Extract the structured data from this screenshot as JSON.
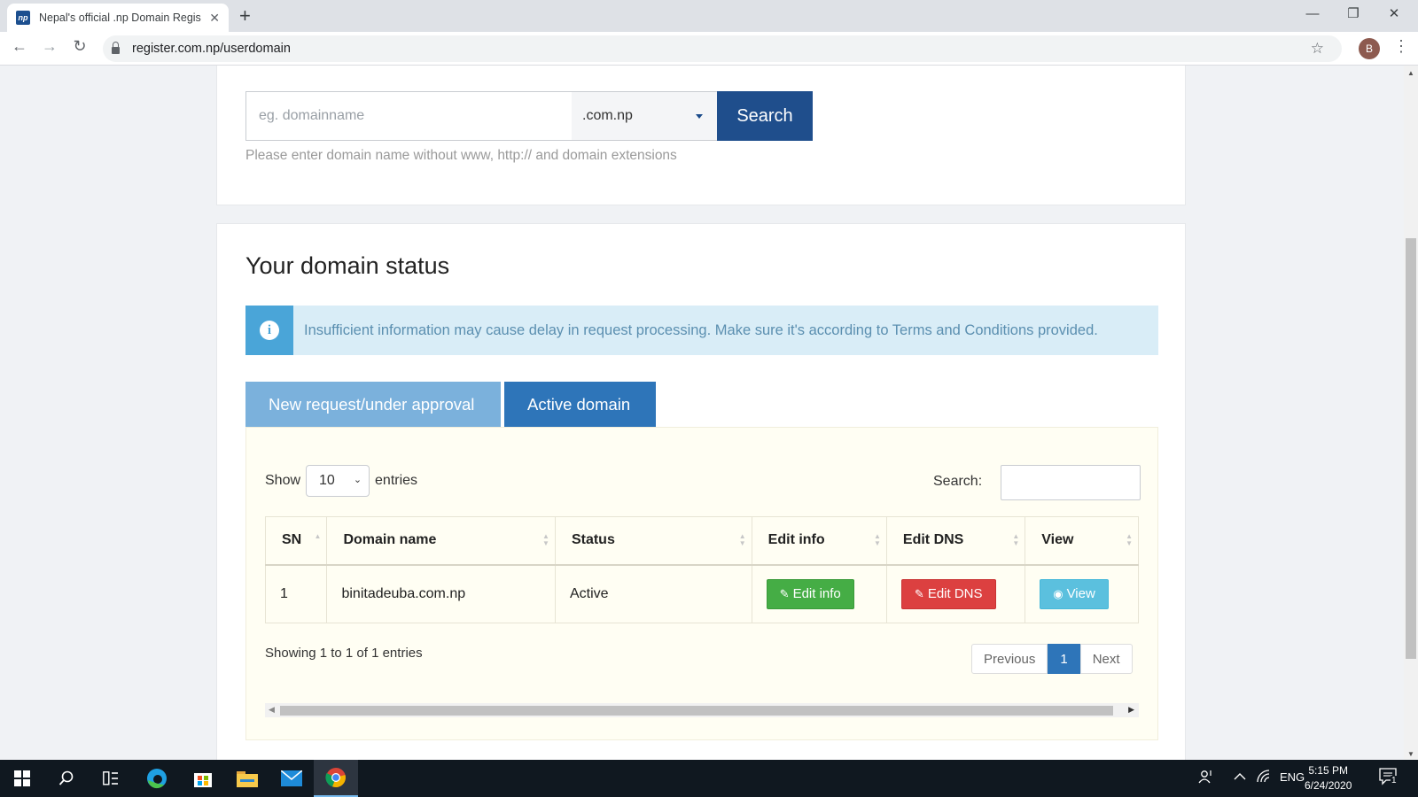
{
  "browser": {
    "tab_title": "Nepal's official .np Domain Regis",
    "tab_favicon_text": "np",
    "tab_close": "✕",
    "new_tab": "+",
    "url": "register.com.np/userdomain",
    "profile_initial": "B",
    "minimize": "—",
    "restore": "❐",
    "close": "✕",
    "back": "←",
    "forward": "→",
    "reload": "↻",
    "star": "☆",
    "menu": "⋮"
  },
  "domain_search": {
    "placeholder": "eg. domainname",
    "extension": ".com.np",
    "search_label": "Search",
    "hint": "Please enter domain name without www, http:// and domain extensions"
  },
  "status_section": {
    "title": "Your domain status",
    "alert_icon": "i",
    "alert_text": "Insufficient information may cause delay in request processing. Make sure it's according to Terms and Conditions provided.",
    "tabs": [
      {
        "label": "New request/under approval",
        "active": false
      },
      {
        "label": "Active domain",
        "active": true
      }
    ]
  },
  "datatable": {
    "show_label": "Show",
    "entries_value": "10",
    "entries_label": "entries",
    "search_label": "Search:",
    "columns": [
      "SN",
      "Domain name",
      "Status",
      "Edit info",
      "Edit DNS",
      "View"
    ],
    "rows": [
      {
        "sn": "1",
        "domain": "binitadeuba.com.np",
        "status": "Active",
        "edit_info": "Edit info",
        "edit_dns": "Edit DNS",
        "view": "View"
      }
    ],
    "info": "Showing 1 to 1 of 1 entries",
    "pager": {
      "previous": "Previous",
      "current": "1",
      "next": "Next"
    }
  },
  "taskbar": {
    "language": "ENG",
    "time": "5:15 PM",
    "date": "6/24/2020",
    "notification_count": "1"
  },
  "colors": {
    "primary": "#1f4e8c",
    "active_tab": "#2e75b9",
    "inactive_tab": "#7bb1dc",
    "success": "#45ad45",
    "danger": "#dc4040",
    "info": "#5bc0de"
  }
}
